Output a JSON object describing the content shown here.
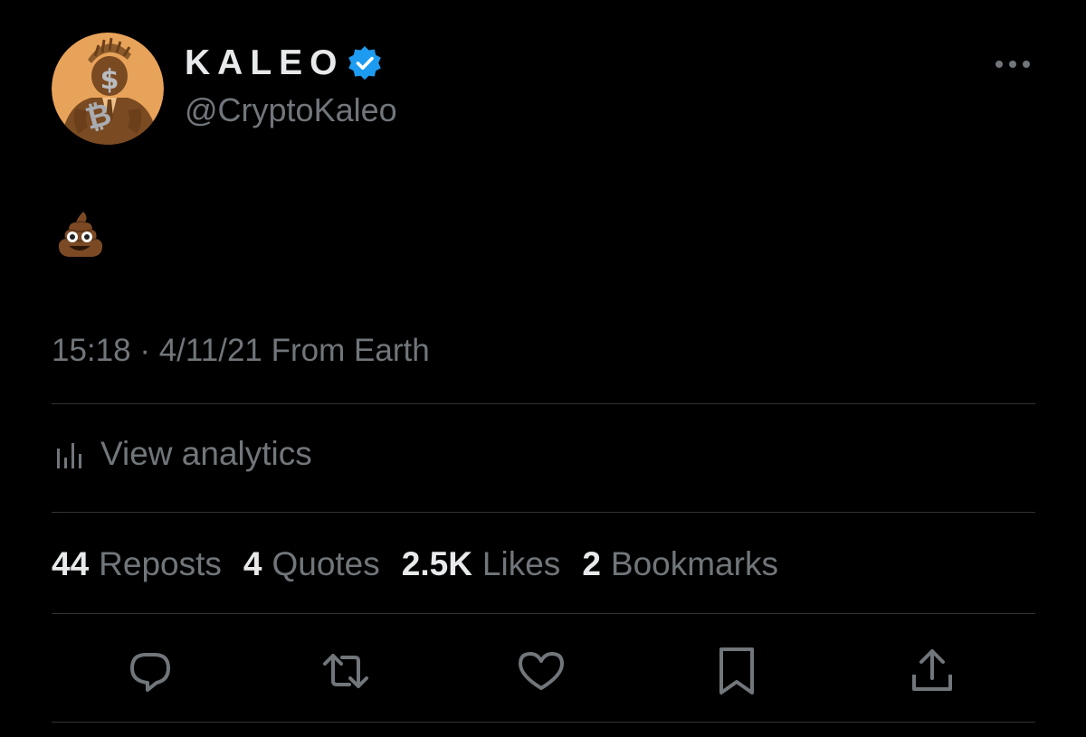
{
  "author": {
    "display_name": "KALEO",
    "handle": "@CryptoKaleo",
    "verified_icon": "verified-badge-icon",
    "verified_color": "#1d9bf0",
    "avatar_icon": "spartan-bitcoin-avatar"
  },
  "menu": {
    "icon": "more-horizontal-icon"
  },
  "tweet": {
    "text": "💩",
    "time": "15:18",
    "separator": "·",
    "date": "4/11/21",
    "source": "From Earth"
  },
  "analytics": {
    "icon": "analytics-bars-icon",
    "label": "View analytics"
  },
  "stats": [
    {
      "value": "44",
      "label": "Reposts"
    },
    {
      "value": "4",
      "label": "Quotes"
    },
    {
      "value": "2.5K",
      "label": "Likes"
    },
    {
      "value": "2",
      "label": "Bookmarks"
    }
  ],
  "actions": [
    {
      "name": "reply",
      "icon": "reply-icon"
    },
    {
      "name": "repost",
      "icon": "repost-icon"
    },
    {
      "name": "like",
      "icon": "heart-icon"
    },
    {
      "name": "bookmark",
      "icon": "bookmark-icon"
    },
    {
      "name": "share",
      "icon": "share-icon"
    }
  ],
  "colors": {
    "background": "#000000",
    "text_primary": "#e7e9ea",
    "text_secondary": "#71767b",
    "divider": "#2f3336",
    "avatar_bg": "#e8a35a",
    "avatar_figure": "#8a5a2b"
  }
}
